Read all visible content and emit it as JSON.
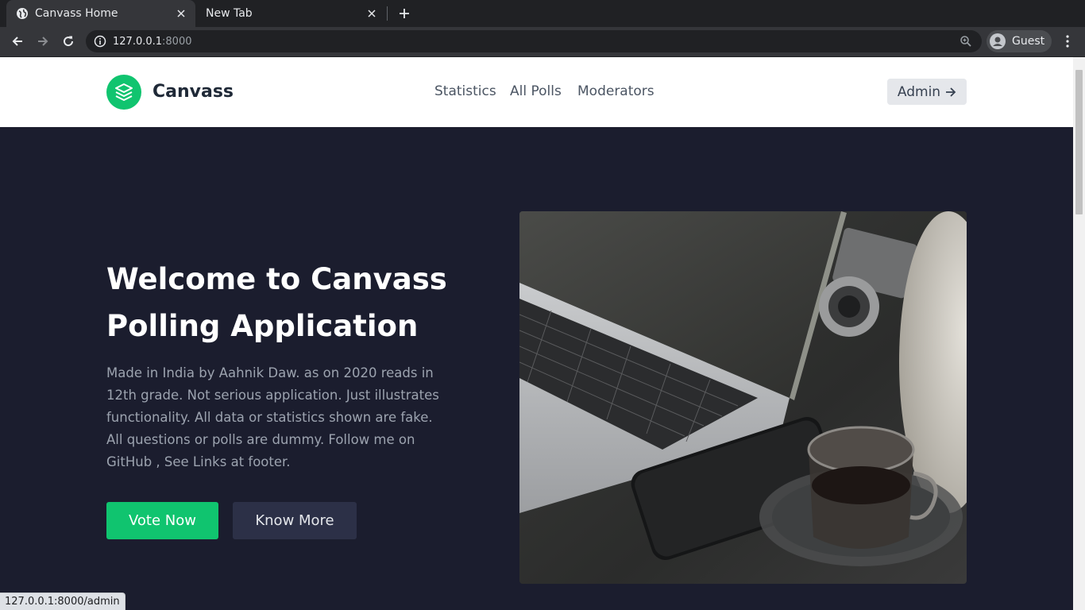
{
  "browser": {
    "tabs": [
      {
        "title": "Canvass Home",
        "active": true
      },
      {
        "title": "New Tab",
        "active": false
      }
    ],
    "url_host": "127.0.0.1",
    "url_port": ":8000",
    "profile_label": "Guest"
  },
  "header": {
    "brand": "Canvass",
    "nav": [
      "Statistics",
      "All Polls",
      "Moderators"
    ],
    "admin_label": "Admin"
  },
  "hero": {
    "title_line1": "Welcome to Canvass",
    "title_line2": "Polling Application",
    "description": "Made in India by Aahnik Daw. as on 2020 reads in 12th grade. Not serious application. Just illustrates functionality. All data or statistics shown are fake. All questions or polls are dummy. Follow me on GitHub , See Links at footer.",
    "vote_button": "Vote Now",
    "know_button": "Know More"
  },
  "status_bar": "127.0.0.1:8000/admin",
  "colors": {
    "accent_green": "#10c46f",
    "hero_background": "#1b1d2e",
    "header_background": "#ffffff"
  },
  "icons": [
    "globe-icon",
    "close-icon",
    "plus-icon",
    "back-arrow-icon",
    "forward-arrow-icon",
    "reload-icon",
    "info-icon",
    "zoom-icon",
    "account-icon",
    "more-vert-icon",
    "layers-icon",
    "arrow-right-icon"
  ]
}
